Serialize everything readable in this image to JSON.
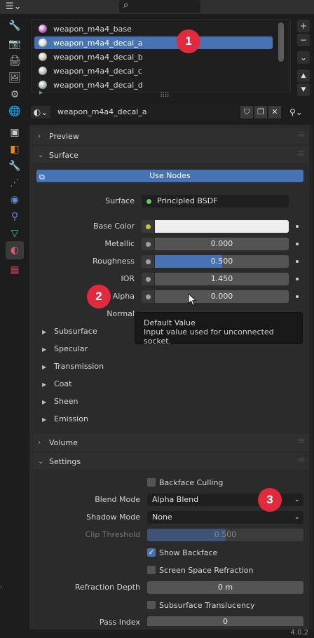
{
  "header": {
    "editor_type_icon": "properties-editor-icon",
    "search_icon": "search-icon"
  },
  "tabs": [
    {
      "name": "tool-icon",
      "glyph": "🔧",
      "color": "#bbbbbb"
    },
    {
      "name": "render-icon",
      "glyph": "📷",
      "color": "#bbbbbb"
    },
    {
      "name": "output-icon",
      "glyph": "🖨",
      "color": "#bbbbbb"
    },
    {
      "name": "view-layer-icon",
      "glyph": "🖼",
      "color": "#bbbbbb"
    },
    {
      "name": "scene-icon",
      "glyph": "⚙",
      "color": "#bbbbbb"
    },
    {
      "name": "world-icon",
      "glyph": "🌐",
      "color": "#c04050"
    },
    {
      "name": "collection-icon",
      "glyph": "▣",
      "color": "#cccccc"
    },
    {
      "name": "object-icon",
      "glyph": "◧",
      "color": "#e08a2a"
    },
    {
      "name": "modifier-icon",
      "glyph": "🔧",
      "color": "#5a8fd8"
    },
    {
      "name": "particles-icon",
      "glyph": "⋰",
      "color": "#5a8fd8"
    },
    {
      "name": "physics-icon",
      "glyph": "◉",
      "color": "#5a8fd8"
    },
    {
      "name": "constraints-icon",
      "glyph": "⚲",
      "color": "#5a8fd8"
    },
    {
      "name": "data-icon",
      "glyph": "▽",
      "color": "#3fbf6f"
    },
    {
      "name": "material-icon",
      "glyph": "◐",
      "color": "#d85a6a"
    },
    {
      "name": "texture-icon",
      "glyph": "▦",
      "color": "#c04050"
    }
  ],
  "slots": [
    {
      "label": "weapon_m4a4_base",
      "color": "#c26ac6"
    },
    {
      "label": "weapon_m4a4_decal_a",
      "color": "#dddddd"
    },
    {
      "label": "weapon_m4a4_decal_b",
      "color": "#c8c8b8"
    },
    {
      "label": "weapon_m4a4_decal_c",
      "color": "#b8c0b8"
    },
    {
      "label": "weapon_m4a4_decal_d",
      "color": "#a8b8b8"
    }
  ],
  "slot_side": {
    "add": "+",
    "remove": "−",
    "specials": "⌄",
    "up": "▲",
    "down": "▼"
  },
  "datablock": {
    "material_name": "weapon_m4a4_decal_a"
  },
  "panels": {
    "preview": "Preview",
    "surface": "Surface",
    "volume": "Volume",
    "settings": "Settings"
  },
  "surface": {
    "use_nodes": "Use Nodes",
    "surface_label": "Surface",
    "surface_shader": "Principled BSDF",
    "props": [
      {
        "label": "Base Color",
        "value": "",
        "fill": 1.0,
        "socket": "yellow"
      },
      {
        "label": "Metallic",
        "value": "0.000",
        "fill": 0.0,
        "socket": "grey"
      },
      {
        "label": "Roughness",
        "value": "0.500",
        "fill": 0.5,
        "socket": "grey"
      },
      {
        "label": "IOR",
        "value": "1.450",
        "fill": 0.0,
        "socket": "grey"
      },
      {
        "label": "Alpha",
        "value": "0.000",
        "fill": 0.0,
        "socket": "grey"
      },
      {
        "label": "Normal",
        "value": "",
        "fill": 0.0,
        "socket": "grey"
      }
    ],
    "subpanels": [
      "Subsurface",
      "Specular",
      "Transmission",
      "Coat",
      "Sheen",
      "Emission"
    ]
  },
  "tooltip": {
    "title": "Default Value",
    "description": "Input value used for unconnected socket."
  },
  "settings": {
    "backface_culling": "Backface Culling",
    "backface_culling_checked": false,
    "blend_mode_label": "Blend Mode",
    "blend_mode_value": "Alpha Blend",
    "shadow_mode_label": "Shadow Mode",
    "shadow_mode_value": "None",
    "clip_threshold_label": "Clip Threshold",
    "clip_threshold_value": "0.500",
    "clip_threshold_fill": 0.5,
    "show_backface": "Show Backface",
    "show_backface_checked": true,
    "screen_space_refraction": "Screen Space Refraction",
    "screen_space_refraction_checked": false,
    "refraction_depth_label": "Refraction Depth",
    "refraction_depth_value": "0 m",
    "subsurface_translucency": "Subsurface Translucency",
    "subsurface_translucency_checked": false,
    "pass_index_label": "Pass Index",
    "pass_index_value": "0"
  },
  "badges": [
    "1",
    "2",
    "3"
  ],
  "status": {
    "version": "4.0.2"
  }
}
